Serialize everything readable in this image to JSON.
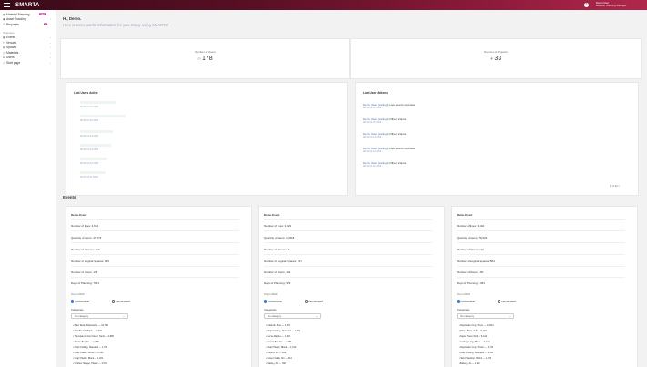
{
  "topbar": {
    "logo": "SMΛRTA",
    "help": "?",
    "user_name": "Demo User",
    "user_role": "Material Planning Manager"
  },
  "sidebar": {
    "top_items": [
      {
        "label": "Material Planning",
        "badge": "NEW"
      },
      {
        "label": "Asset Tracking"
      },
      {
        "label": "Requests",
        "badge": "0"
      }
    ],
    "section_label": "Overview",
    "items": [
      {
        "label": "Events"
      },
      {
        "label": "Venues"
      },
      {
        "label": "Spaces"
      },
      {
        "label": "Materials"
      },
      {
        "label": "Users"
      },
      {
        "label": "Start page"
      }
    ]
  },
  "greeting": "Hi, Demo.",
  "subgreeting": "Here is some useful information for you. Enjoy using SMΛRTA!",
  "stats": [
    {
      "label": "Number of Users",
      "value": "178"
    },
    {
      "label": "Number of Projects",
      "value": "33"
    }
  ],
  "last_users": {
    "title": "Last Users Active",
    "dates": [
      "06.23 14:16 2023",
      "06.23 14:15 2023",
      "06.23 14:14 2023",
      "06.23 14:13 2023",
      "06.23 14:12 2023",
      "06.23 14:11 2023"
    ]
  },
  "last_actions": {
    "title": "Last User Actions",
    "items": [
      {
        "name": "Demo User (testing1)",
        "action": "Live events overview",
        "date": "06.23 14:16 2023"
      },
      {
        "name": "Demo User (testing1)",
        "action": "Other actions",
        "date": "06.23 14:15 2023"
      },
      {
        "name": "Demo User (testing1)",
        "action": "Other actions",
        "date": "06.23 14:14 2023"
      },
      {
        "name": "Demo User (testing1)",
        "action": "Live events overview",
        "date": "06.23 14:13 2023"
      },
      {
        "name": "Demo User (testing1)",
        "action": "Other actions",
        "date": "06.23 14:12 2023"
      }
    ],
    "pager": "1 of 34 >"
  },
  "events_title": "Events",
  "events": [
    {
      "title": "Demo Event",
      "rows": [
        "Number of lines: 4,661",
        "Quantity of items: 47,773",
        "Number of Venues: 123",
        "Number of Logical Spaces: 396",
        "Number of Users: 173",
        "Days of Planning: 7061"
      ],
      "top_in": "Top in 2023",
      "radio1": "Consumable",
      "radio2": "Last Booked",
      "categories_label": "Categories",
      "select": "No category",
      "list": [
        "Plain Desk, Disposable — 34,788",
        "Wall Bench, Black — 2,933",
        "Transparent Fire Folder, Sand — 2,880",
        "Trestle Bar, 2m — 1,875",
        "Chair Folding, Standard — 1,784",
        "Chair Plastic, White — 1,432",
        "Chair Plastic, Black — 1,201",
        "Clothes Hanger, Plastic — 1,073"
      ]
    },
    {
      "title": "Demo Event",
      "rows": [
        "Number of lines: 3,122",
        "Quantity of items: 18,818",
        "Number of Venues: 7",
        "Number of Logical Spaces: 197",
        "Number of Users: 122",
        "Days of Planning: 979"
      ],
      "top_in": "Top in 2023",
      "radio1": "Consumable",
      "radio2": "Last Booked",
      "categories_label": "Categories",
      "select": "No category",
      "list": [
        "Bollards, Blue — 1,871",
        "Chair Folding, Standard — 1,661",
        "Fence Barrier — 1,318",
        "Trestle Bar, 2m — 1,151",
        "Chair Plastic, Black — 1,012",
        "Bollard, 1m — 938",
        "Power Cable, 5m — 814",
        "Battery, AA — 798"
      ]
    },
    {
      "title": "Demo Event",
      "rows": [
        "Number of lines: 3,604",
        "Quantity of items: 59,623",
        "Number of Venues: 22",
        "Number of Logical Spaces: 564",
        "Number of Users: 150",
        "Days of Planning: 1381"
      ],
      "top_in": "Top in 2023",
      "radio1": "Consumable",
      "radio2": "Last Booked",
      "categories_label": "Categories",
      "select": "No category",
      "list": [
        "Disposable Cup, Paper — 10,612",
        "Water Bottle, 0.5l — 8,118",
        "Paper Towel, Roll — 5,412",
        "Garbage Bag, Black — 4,211",
        "Disposable Cup, Plastic — 3,702",
        "Chair Folding, Standard — 2,011",
        "Hand Sanitizer, 500ml — 1,702",
        "Battery, AA — 1,212"
      ]
    }
  ]
}
